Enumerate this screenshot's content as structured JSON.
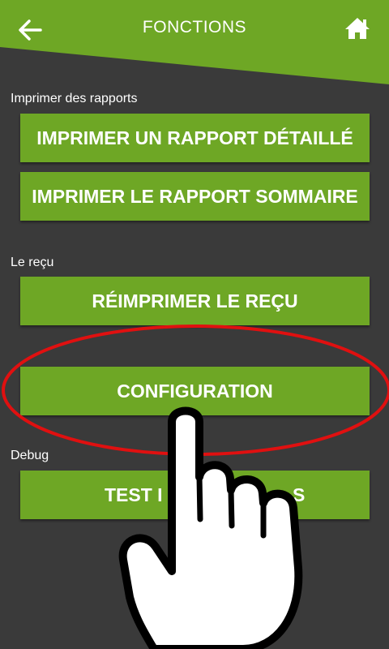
{
  "header": {
    "title": "FONCTIONS",
    "back_icon": "arrow-left-icon",
    "home_icon": "home-icon",
    "background_color": "#6ea725"
  },
  "sections": {
    "reports_label": "Imprimer des rapports",
    "receipt_label": "Le reçu",
    "debug_label": "Debug"
  },
  "buttons": {
    "detailed_report": "IMPRIMER UN RAPPORT DÉTAILLÉ",
    "summary_report": "IMPRIMER LE RAPPORT SOMMAIRE",
    "reprint_receipt": "RÉIMPRIMER LE REÇU",
    "configuration": "CONFIGURATION",
    "test_partial": "TEST I",
    "test_partial_tail": "S"
  },
  "overlay": {
    "highlight": "red-ellipse",
    "pointer": "hand-pointer-icon",
    "highlight_color": "#e01010"
  },
  "colors": {
    "accent": "#6ea725",
    "background": "#3a3a3a",
    "text": "#ffffff"
  }
}
